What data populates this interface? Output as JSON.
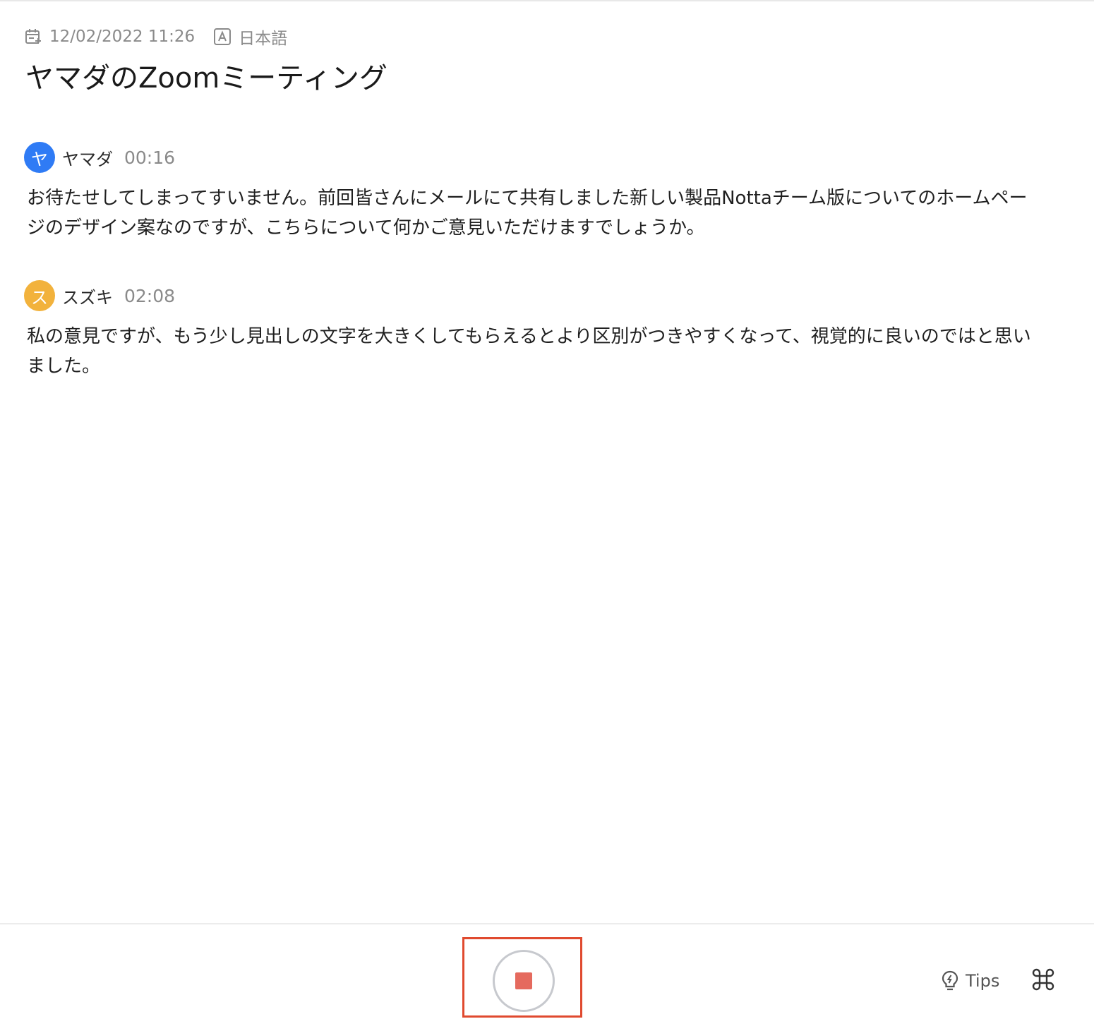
{
  "meta": {
    "date": "12/02/2022 11:26",
    "language": "日本語",
    "date_icon": "calendar-icon",
    "language_icon": "language-a-icon"
  },
  "title": "ヤマダのZoomミーティング",
  "transcript": [
    {
      "avatar_initial": "ヤ",
      "avatar_color": "#2f7bf5",
      "speaker": "ヤマダ",
      "time": "00:16",
      "text": "お待たせしてしまってすいません。前回皆さんにメールにて共有しました新しい製品Nottaチーム版についてのホームページのデザイン案なのですが、こちらについて何かご意見いただけますでしょうか。"
    },
    {
      "avatar_initial": "ス",
      "avatar_color": "#f2b23c",
      "speaker": "スズキ",
      "time": "02:08",
      "text": "私の意見ですが、もう少し見出しの文字を大きくしてもらえるとより区別がつきやすくなって、視覚的に良いのではと思いました。"
    }
  ],
  "controls": {
    "stop_icon": "stop-icon",
    "tips_label": "Tips",
    "tips_icon": "lightbulb-icon",
    "shortcut_icon": "command-key-icon",
    "stop_color": "#e56a5e",
    "highlight_color": "#e04a2f"
  }
}
